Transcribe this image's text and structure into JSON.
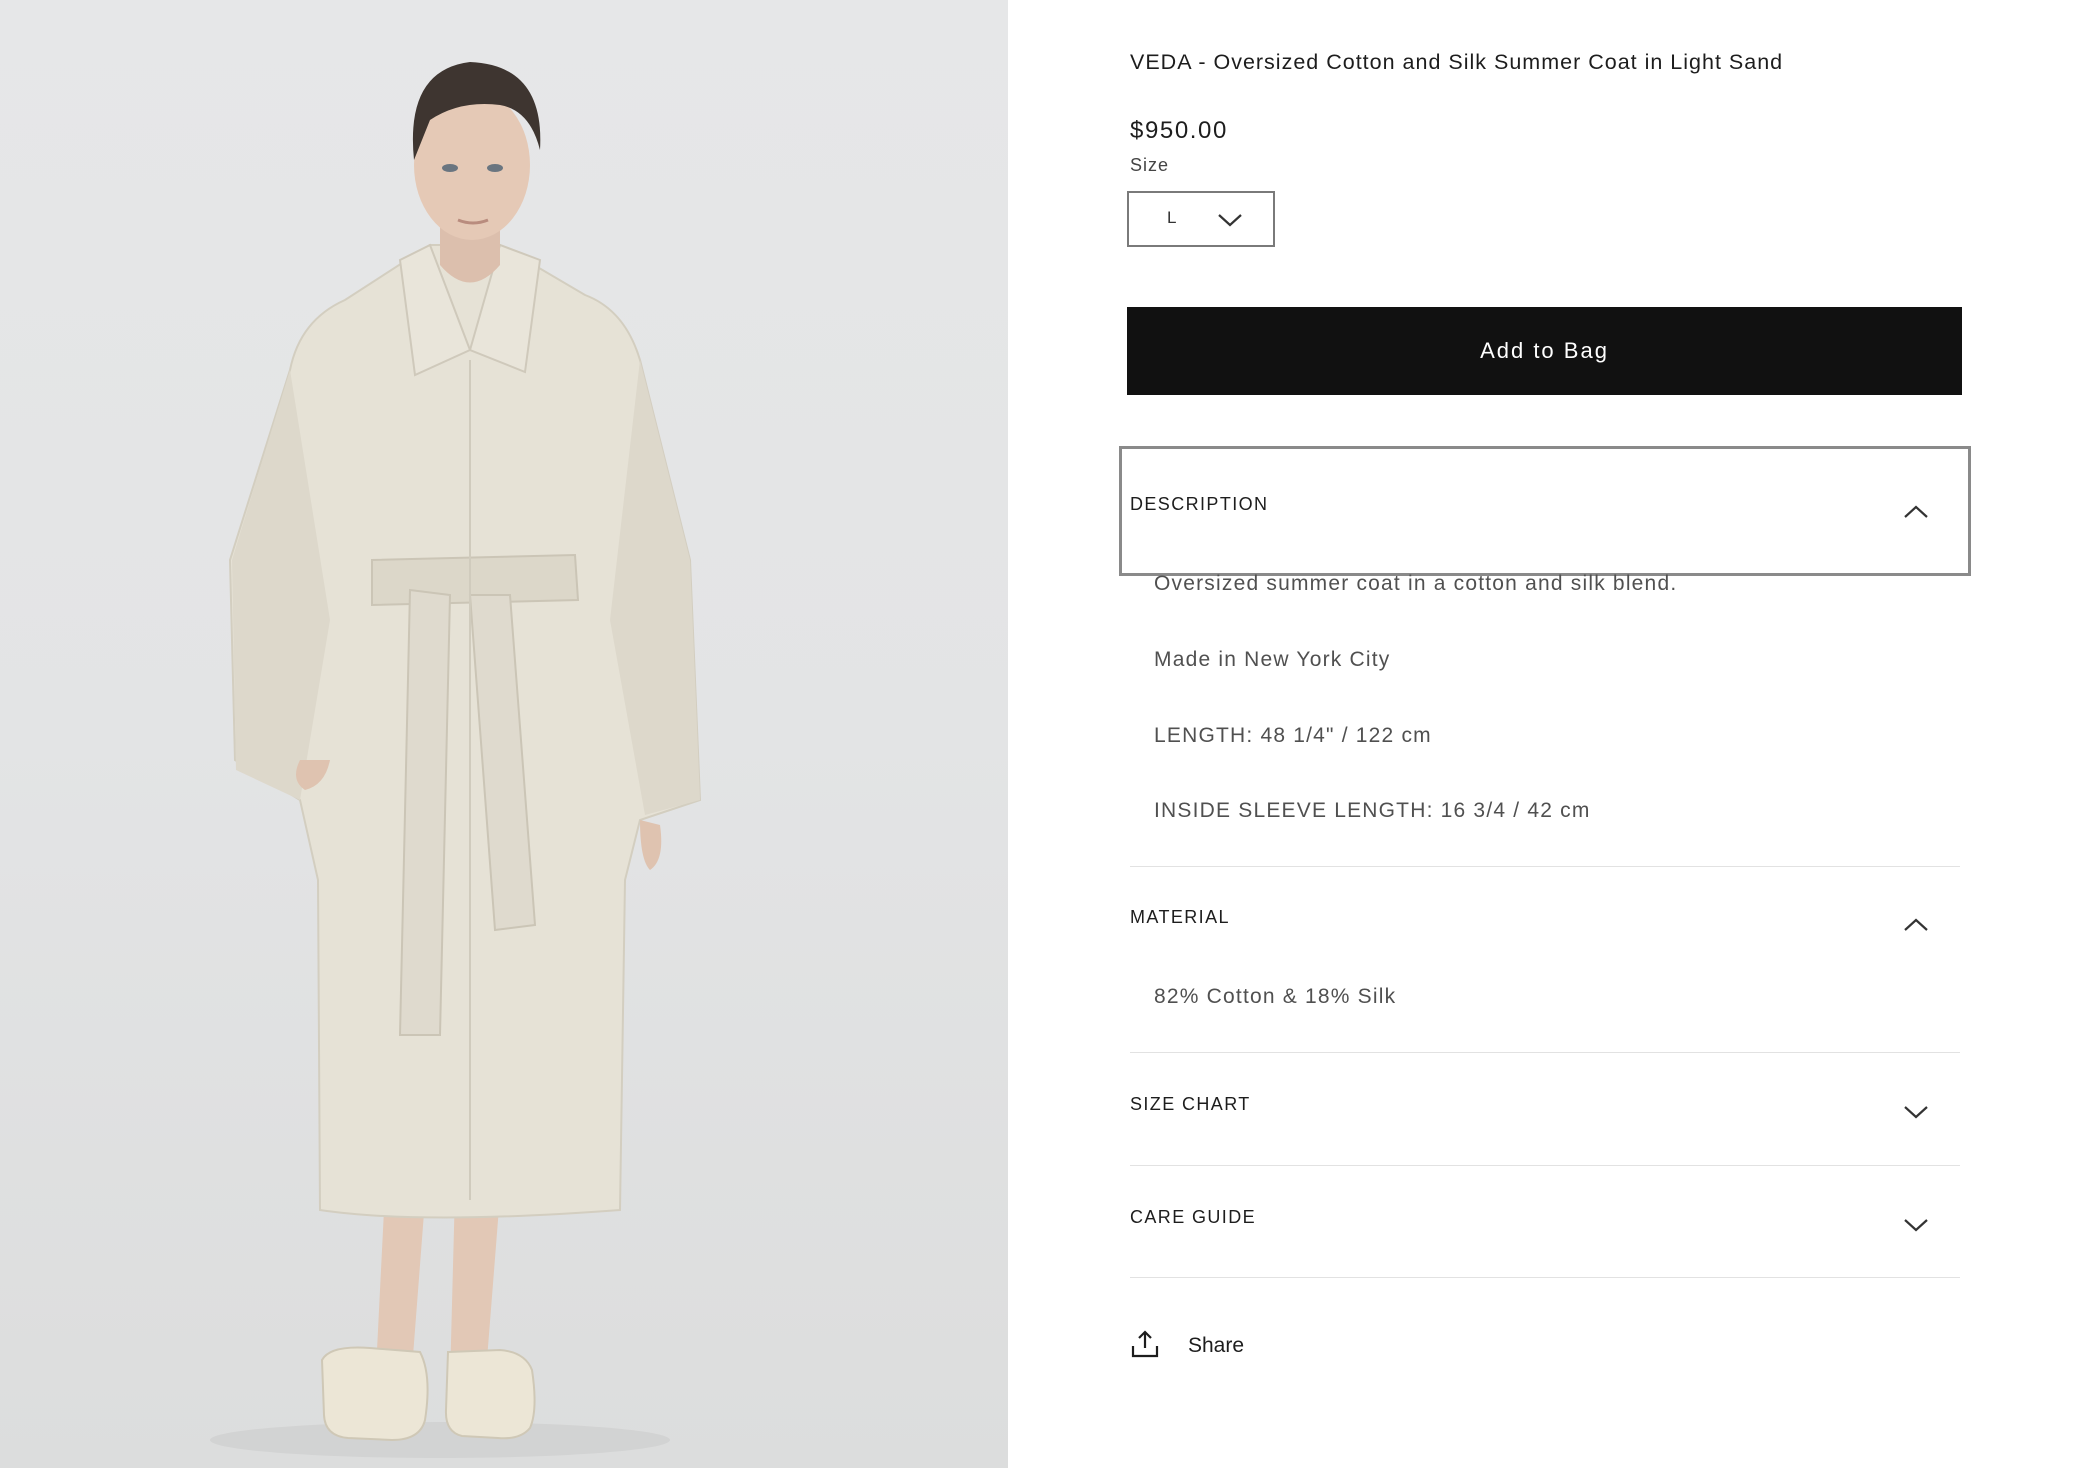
{
  "product": {
    "title": "VEDA - Oversized Cotton and Silk Summer Coat in Light Sand",
    "price": "$950.00",
    "size_label": "Size",
    "size_selected": "L",
    "add_to_bag_label": "Add to Bag",
    "image_icon": "model-photo"
  },
  "accordion": [
    {
      "label": "DESCRIPTION",
      "state": "expanded",
      "icon": "chevron-up-icon",
      "lines": [
        "Oversized summer coat in a cotton and silk blend.",
        "Made in New York City",
        "LENGTH: 48 1/4\" / 122 cm",
        "INSIDE SLEEVE LENGTH: 16 3/4 / 42 cm"
      ]
    },
    {
      "label": "MATERIAL",
      "state": "expanded",
      "icon": "chevron-up-icon",
      "lines": [
        "82% Cotton & 18% Silk"
      ]
    },
    {
      "label": "SIZE CHART",
      "state": "collapsed",
      "icon": "chevron-down-icon",
      "lines": []
    },
    {
      "label": "CARE GUIDE",
      "state": "collapsed",
      "icon": "chevron-down-icon",
      "lines": []
    }
  ],
  "share": {
    "label": "Share",
    "icon": "share-upload-icon"
  },
  "colors": {
    "button_bg": "#111111",
    "button_text": "#ffffff",
    "focus_ring": "#8a8a8a",
    "coat": "#e4e0d5",
    "background_photo": "#e4e5e6"
  }
}
